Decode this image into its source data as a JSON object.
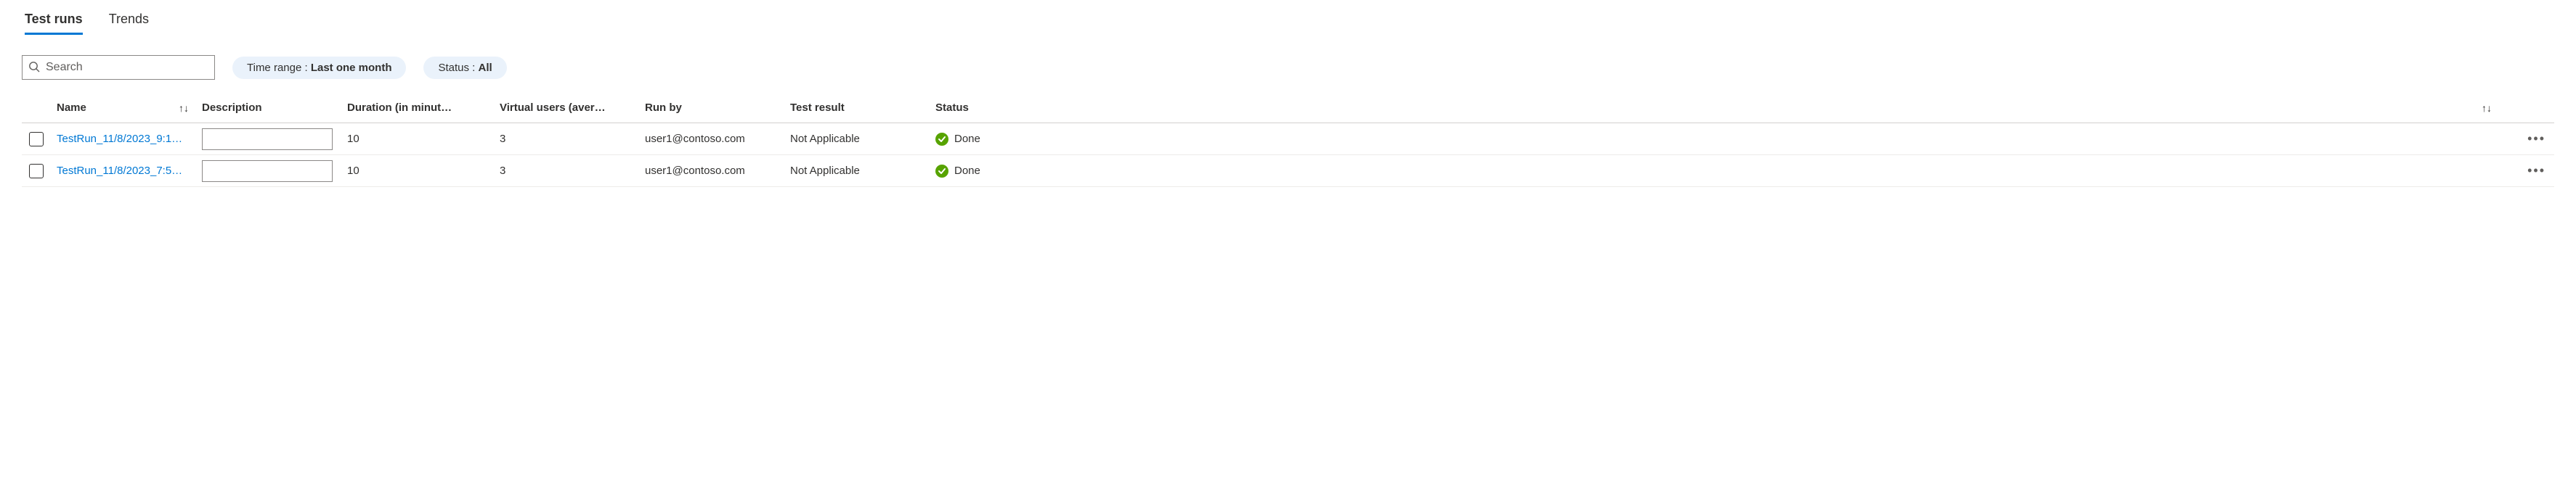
{
  "tabs": {
    "test_runs": "Test runs",
    "trends": "Trends"
  },
  "search": {
    "placeholder": "Search"
  },
  "filters": {
    "time_range_label": "Time range : ",
    "time_range_value": "Last one month",
    "status_label": "Status : ",
    "status_value": "All"
  },
  "columns": {
    "name": "Name",
    "description": "Description",
    "duration": "Duration (in minut…",
    "virtual_users": "Virtual users (aver…",
    "run_by": "Run by",
    "test_result": "Test result",
    "status": "Status"
  },
  "rows": [
    {
      "name": "TestRun_11/8/2023_9:1…",
      "description": "",
      "duration": "10",
      "virtual_users": "3",
      "run_by": "user1@contoso.com",
      "test_result": "Not Applicable",
      "status": "Done"
    },
    {
      "name": "TestRun_11/8/2023_7:5…",
      "description": "",
      "duration": "10",
      "virtual_users": "3",
      "run_by": "user1@contoso.com",
      "test_result": "Not Applicable",
      "status": "Done"
    }
  ],
  "icons": {
    "sort": "↑↓",
    "more": "•••"
  }
}
